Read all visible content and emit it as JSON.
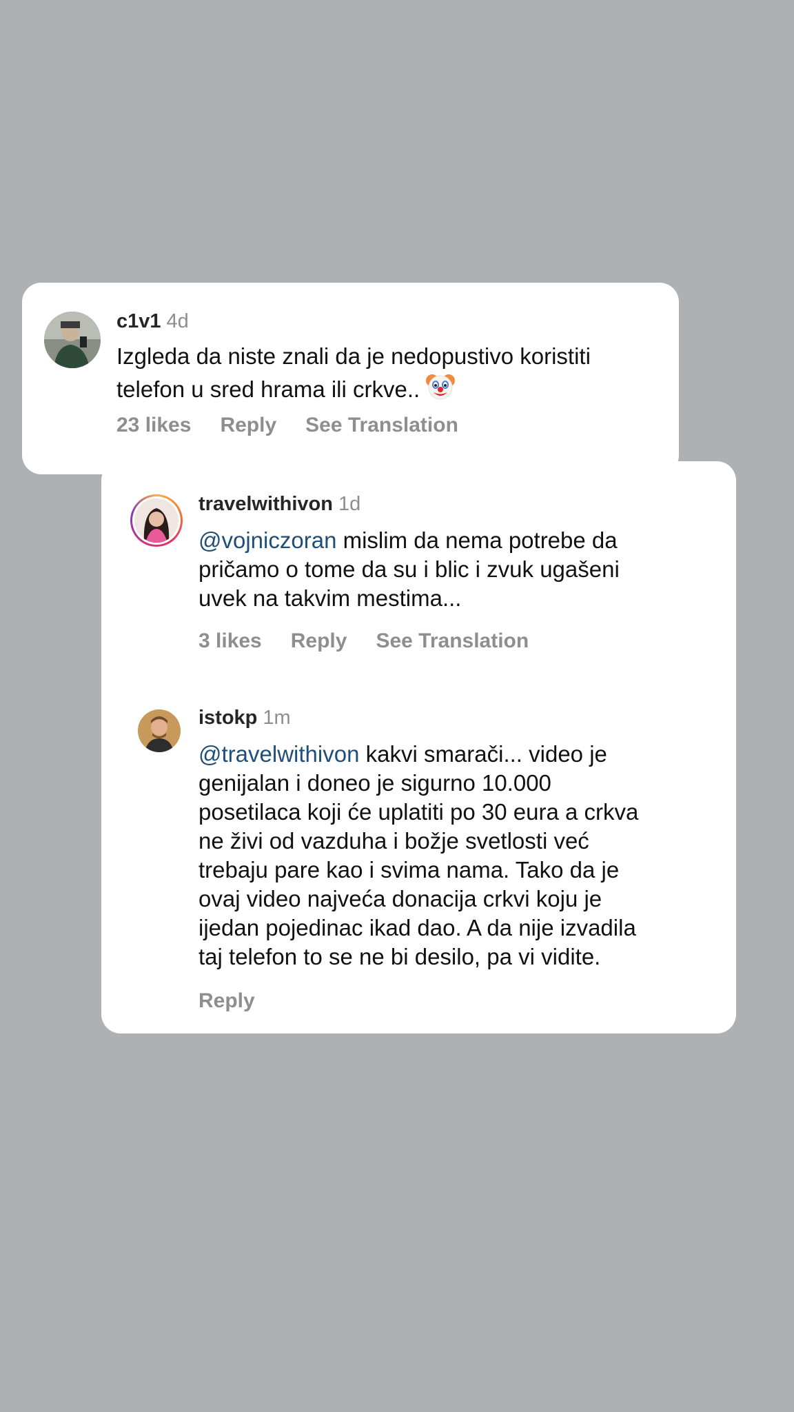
{
  "comments": [
    {
      "username": "c1v1",
      "time": "4d",
      "text_lines": [
        "Izgleda da niste znali da je nedopustivo koristiti",
        "telefon u sred hrama ili crkve.."
      ],
      "emoji": "clown-face-icon",
      "likes": "23 likes",
      "reply": "Reply",
      "translation": "See Translation"
    },
    {
      "username": "travelwithivon",
      "time": "1d",
      "mention": "@vojniczoran",
      "text_lines": [
        " mislim da nema potrebe da",
        "pričamo o tome da su i blic i zvuk ugašeni",
        "uvek na takvim mestima..."
      ],
      "likes": "3 likes",
      "reply": "Reply",
      "translation": "See Translation"
    },
    {
      "username": "istokp",
      "time": "1m",
      "mention": "@travelwithivon",
      "text_lines": [
        " kakvi smarači... video je",
        "genijalan i doneo je sigurno 10.000",
        "posetilaca koji će uplatiti po 30 eura a crkva",
        "ne živi od vazduha i božje svetlosti već",
        "trebaju pare kao i svima nama. Tako da je",
        "ovaj video najveća donacija crkvi koju je",
        "ijedan pojedinac ikad dao. A da nije izvadila",
        "taj telefon to se ne bi desilo, pa vi vidite."
      ],
      "reply": "Reply"
    }
  ],
  "colors": {
    "background": "#aeb1b4",
    "card": "#ffffff",
    "mention": "#1f4f79",
    "secondary_text": "#8e8e8e"
  }
}
